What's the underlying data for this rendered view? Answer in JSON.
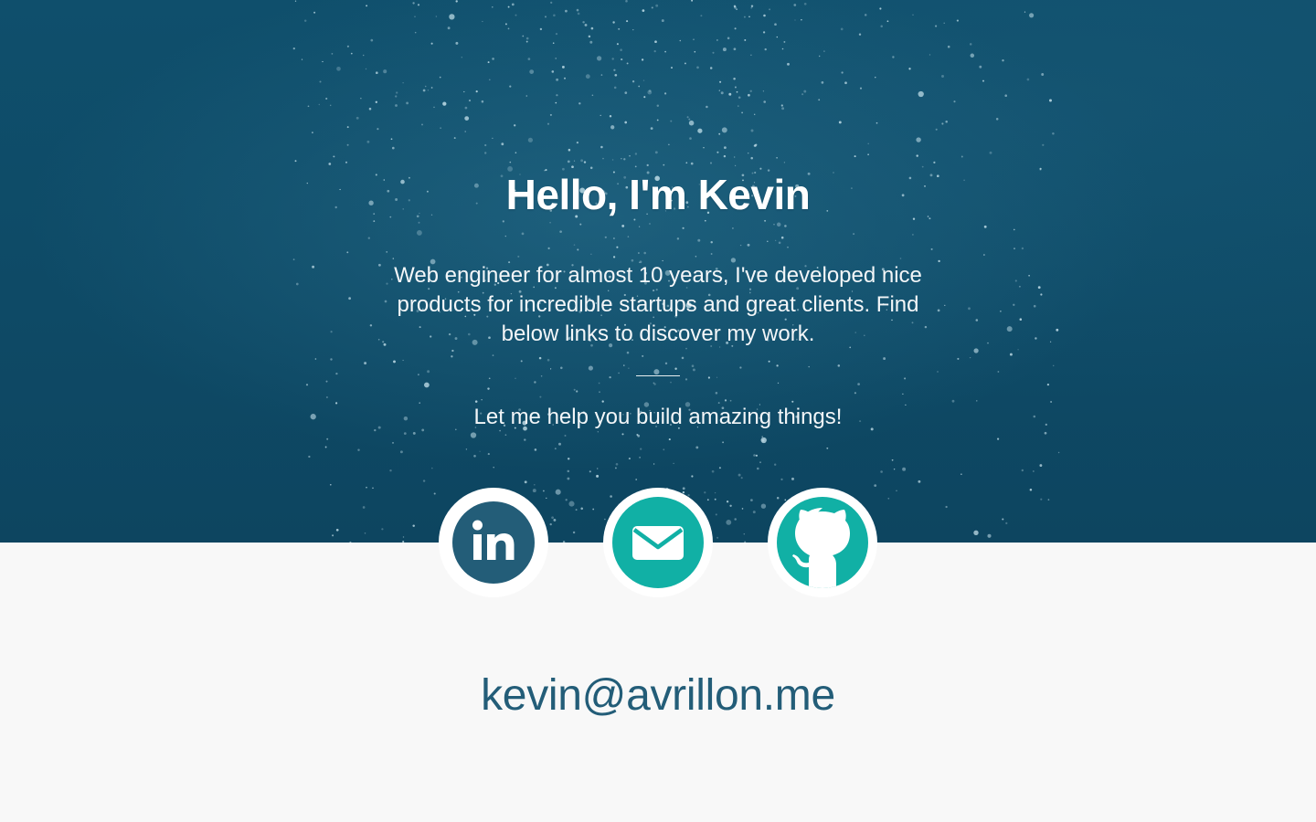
{
  "hero": {
    "title": "Hello, I'm Kevin",
    "description": "Web engineer for almost 10 years, I've developed nice products for incredible startups and great clients. Find below links to discover my work.",
    "tagline": "Let me help you build amazing things!"
  },
  "social": [
    {
      "name": "LinkedIn",
      "icon": "linkedin-icon",
      "color": "#235d78"
    },
    {
      "name": "Email",
      "icon": "mail-icon",
      "color": "#11b0a5"
    },
    {
      "name": "GitHub",
      "icon": "github-icon",
      "color": "#11b0a5"
    }
  ],
  "contact": {
    "email": "kevin@avrillon.me"
  },
  "colors": {
    "hero_background": "#0e4a66",
    "accent": "#11b0a5",
    "primary": "#235d78",
    "page_background": "#f8f8f8"
  }
}
